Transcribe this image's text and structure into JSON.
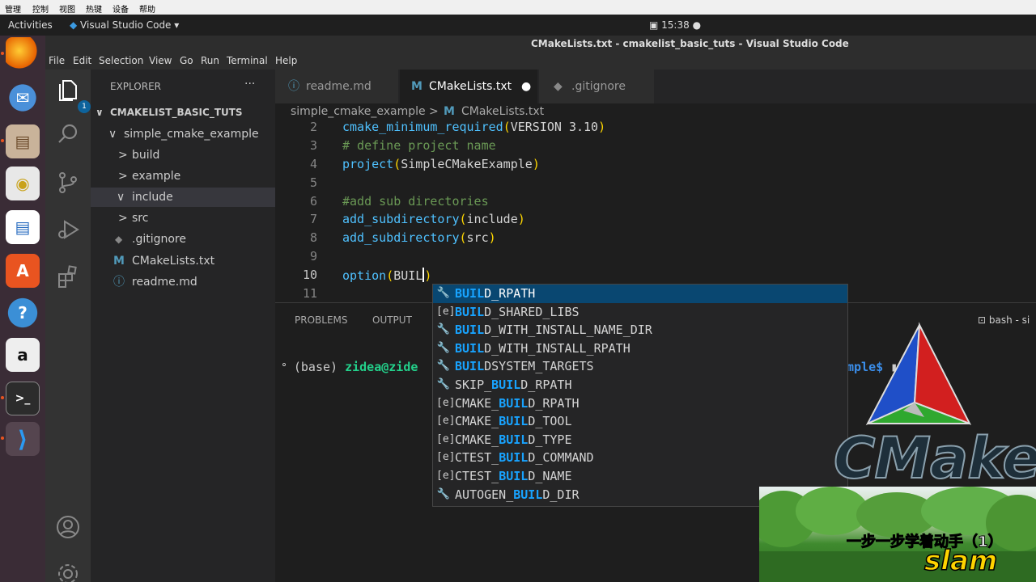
{
  "host_menu": [
    "管理",
    "控制",
    "视图",
    "热键",
    "设备",
    "帮助"
  ],
  "topbar": {
    "activities": "Activities",
    "app_name": "Visual Studio Code ▾",
    "clock": "15:38"
  },
  "window": {
    "title": "CMakeLists.txt - cmakelist_basic_tuts - Visual Studio Code"
  },
  "menu": [
    "File",
    "Edit",
    "Selection",
    "View",
    "Go",
    "Run",
    "Terminal",
    "Help"
  ],
  "activity_badge": "1",
  "explorer": {
    "header": "EXPLORER",
    "more": "···",
    "root": "CMAKELIST_BASIC_TUTS",
    "items": [
      {
        "label": "simple_cmake_example",
        "twisty": "∨"
      },
      {
        "label": "build",
        "twisty": ">"
      },
      {
        "label": "example",
        "twisty": ">"
      },
      {
        "label": "include",
        "twisty": "∨"
      },
      {
        "label": "src",
        "twisty": ">"
      },
      {
        "label": ".gitignore",
        "icon": "◆"
      },
      {
        "label": "CMakeLists.txt",
        "icon": "M"
      },
      {
        "label": "readme.md",
        "icon": "ⓘ"
      }
    ]
  },
  "tabs": [
    {
      "label": "readme.md",
      "icon": "ⓘ"
    },
    {
      "label": "CMakeLists.txt",
      "icon": "M",
      "dirty": "●"
    },
    {
      "label": ".gitignore",
      "icon": "◆"
    }
  ],
  "breadcrumb": {
    "folder": "simple_cmake_example",
    "sep": ">",
    "icon": "M",
    "file": "CMakeLists.txt"
  },
  "editor": {
    "line_numbers": [
      "2",
      "3",
      "4",
      "5",
      "6",
      "7",
      "8",
      "9",
      "10",
      "11"
    ],
    "line2": {
      "fn": "cmake_minimum_required",
      "open": "(",
      "arg": "VERSION 3.10",
      "close": ")"
    },
    "line3": "# define project name",
    "line4": {
      "fn": "project",
      "open": "(",
      "arg": "SimpleCMakeExample",
      "close": ")"
    },
    "line6": "#add sub directories",
    "line7": {
      "fn": "add_subdirectory",
      "open": "(",
      "arg": "include",
      "close": ")"
    },
    "line8": {
      "fn": "add_subdirectory",
      "open": "(",
      "arg": "src",
      "close": ")"
    },
    "line10": {
      "fn": "option",
      "open": "(",
      "arg": "BUIL",
      "close": ")"
    }
  },
  "panel": {
    "tab1": "PROBLEMS",
    "tab2": "OUTPUT",
    "bash_label": "bash - si"
  },
  "terminal": {
    "prefix": "ᐤ (base) ",
    "user": "zidea@zide",
    "suffix": "mple$",
    "cursor": " ▮"
  },
  "suggestions": [
    {
      "icon": "🔧",
      "match": "BUIL",
      "rest": "D_RPATH",
      "pre": ""
    },
    {
      "icon": "[e]",
      "match": "BUIL",
      "rest": "D_SHARED_LIBS",
      "pre": ""
    },
    {
      "icon": "🔧",
      "match": "BUIL",
      "rest": "D_WITH_INSTALL_NAME_DIR",
      "pre": ""
    },
    {
      "icon": "🔧",
      "match": "BUIL",
      "rest": "D_WITH_INSTALL_RPATH",
      "pre": ""
    },
    {
      "icon": "🔧",
      "match": "BUIL",
      "rest": "DSYSTEM_TARGETS",
      "pre": ""
    },
    {
      "icon": "🔧",
      "pre": "SKIP_",
      "match": "BUIL",
      "rest": "D_RPATH"
    },
    {
      "icon": "[e]",
      "pre": "CMAKE_",
      "match": "BUIL",
      "rest": "D_RPATH"
    },
    {
      "icon": "[e]",
      "pre": "CMAKE_",
      "match": "BUIL",
      "rest": "D_TOOL"
    },
    {
      "icon": "[e]",
      "pre": "CMAKE_",
      "match": "BUIL",
      "rest": "D_TYPE"
    },
    {
      "icon": "[e]",
      "pre": "CTEST_",
      "match": "BUIL",
      "rest": "D_COMMAND"
    },
    {
      "icon": "[e]",
      "pre": "CTEST_",
      "match": "BUIL",
      "rest": "D_NAME"
    },
    {
      "icon": "🔧",
      "pre": "AUTOGEN_",
      "match": "BUIL",
      "rest": "D_DIR"
    }
  ],
  "logo": {
    "word": "CMake"
  },
  "inset": {
    "subtitle": "一步一步学着动手（1）",
    "title": "slam"
  },
  "colors": {
    "accent": "#0e639c",
    "selection": "#094771",
    "match": "#18a3ff"
  }
}
